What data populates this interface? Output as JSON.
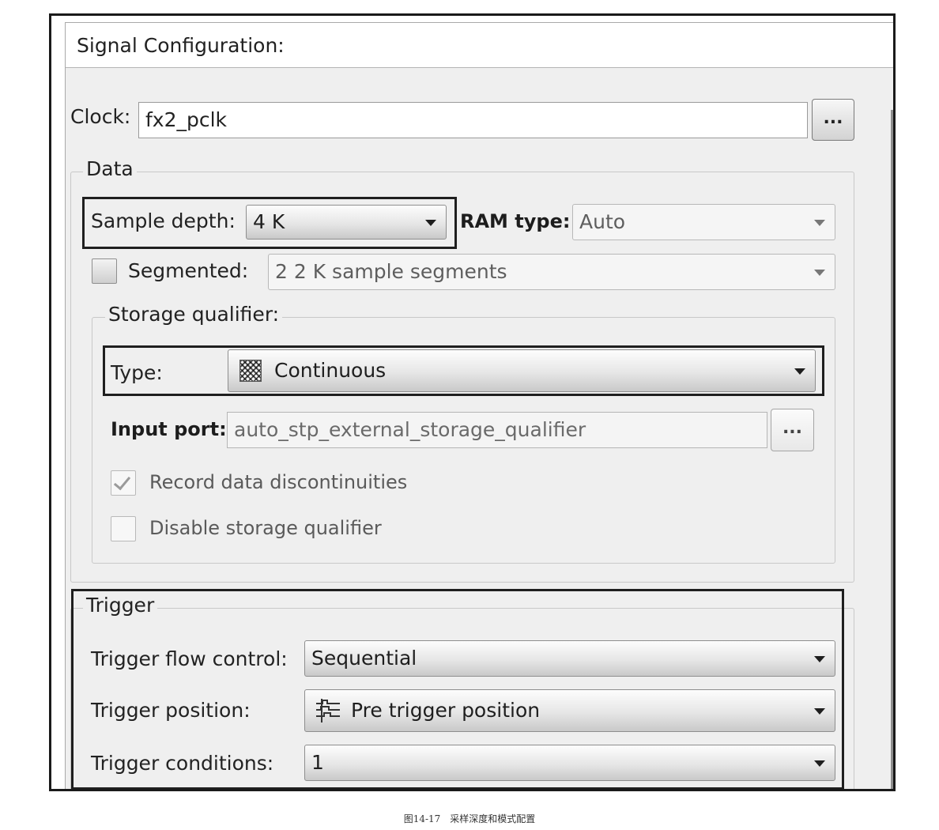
{
  "panel": {
    "title": "Signal Configuration:"
  },
  "clock": {
    "label": "Clock:",
    "value": "fx2_pclk",
    "browse_label": "..."
  },
  "data_group": {
    "title": "Data",
    "sample_depth": {
      "label": "Sample depth:",
      "value": "4 K"
    },
    "ram_type": {
      "label": "RAM type:",
      "value": "Auto"
    },
    "segmented": {
      "label": "Segmented:",
      "checked": false,
      "value": "2  2 K sample segments"
    },
    "storage_qualifier": {
      "title": "Storage qualifier:",
      "type": {
        "label": "Type:",
        "value": "Continuous",
        "icon": "continuous-hatch-icon"
      },
      "input_port": {
        "label": "Input port:",
        "value": "auto_stp_external_storage_qualifier",
        "browse_label": "..."
      },
      "record_discontinuities": {
        "label": "Record data discontinuities",
        "checked": true
      },
      "disable_qualifier": {
        "label": "Disable storage qualifier",
        "checked": false
      }
    }
  },
  "trigger_group": {
    "title": "Trigger",
    "flow_control": {
      "label": "Trigger flow control:",
      "value": "Sequential"
    },
    "position": {
      "label": "Trigger position:",
      "value": "Pre trigger position",
      "icon": "pre-trigger-wave-icon"
    },
    "conditions": {
      "label": "Trigger conditions:",
      "value": "1"
    }
  },
  "caption": "图14-17　采样深度和模式配置"
}
